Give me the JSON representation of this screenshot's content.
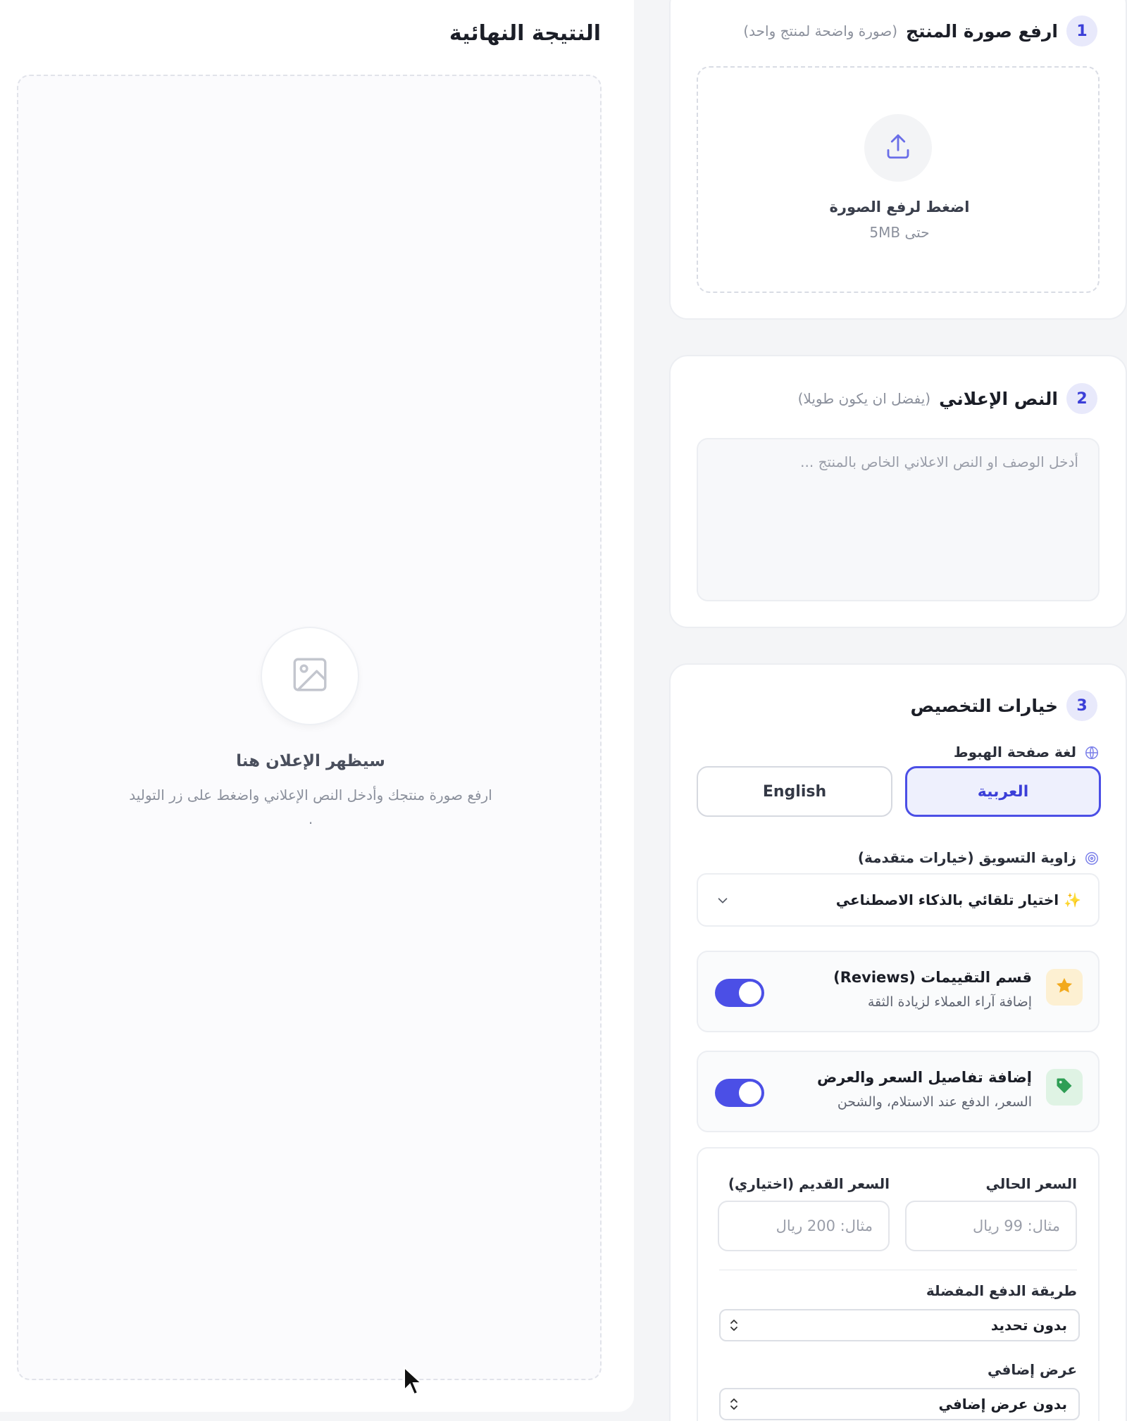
{
  "result": {
    "title": "النتيجة النهائية",
    "placeholder_title": "سيظهر الإعلان هنا",
    "placeholder_desc": "ارفع صورة منتجك وأدخل النص الإعلاني واضغط على زر التوليد ."
  },
  "step1": {
    "num": "1",
    "title": "ارفع صورة المنتج",
    "hint": "(صورة واضحة لمنتج واحد)",
    "upload_label": "اضغط لرفع الصورة",
    "upload_size": "حتى 5MB"
  },
  "step2": {
    "num": "2",
    "title": "النص الإعلاني",
    "hint": "(يفضل ان يكون طويلا)",
    "placeholder": "أدخل الوصف او النص الاعلاني الخاص بالمنتج ..."
  },
  "step3": {
    "num": "3",
    "title": "خيارات التخصيص",
    "lang_label": "لغة صفحة الهبوط",
    "lang_ar": "العربية",
    "lang_en": "English",
    "angle_label": "زاوية التسويق (خيارات متقدمة)",
    "angle_value": "✨ اختيار تلقائي بالذكاء الاصطناعي",
    "reviews_title": "قسم التقييمات (Reviews)",
    "reviews_sub": "إضافة آراء العملاء لزيادة الثقة",
    "reviews_on": true,
    "price_title": "إضافة تفاصيل السعر والعرض",
    "price_sub": "السعر، الدفع عند الاستلام، والشحن",
    "price_on": true,
    "current_price_label": "السعر الحالي",
    "current_price_placeholder": "مثال: 99 ريال",
    "old_price_label": "السعر القديم (اختياري)",
    "old_price_placeholder": "مثال: 200 ريال",
    "payment_label": "طريقة الدفع المفضلة",
    "payment_value": "بدون تحديد",
    "offer_label": "عرض إضافي",
    "offer_value": "بدون عرض إضافي"
  },
  "colors": {
    "accent": "#4b4fe6",
    "star_bg": "#fdf0d2",
    "star": "#f2a91c",
    "tag_bg": "#dff3e4",
    "tag": "#2f9e55"
  },
  "icons": {
    "upload": "upload-icon",
    "image_placeholder": "image-icon",
    "globe": "globe-icon",
    "target": "target-icon",
    "chevron": "chevron-down-icon",
    "star": "star-icon",
    "tag": "tag-icon"
  }
}
